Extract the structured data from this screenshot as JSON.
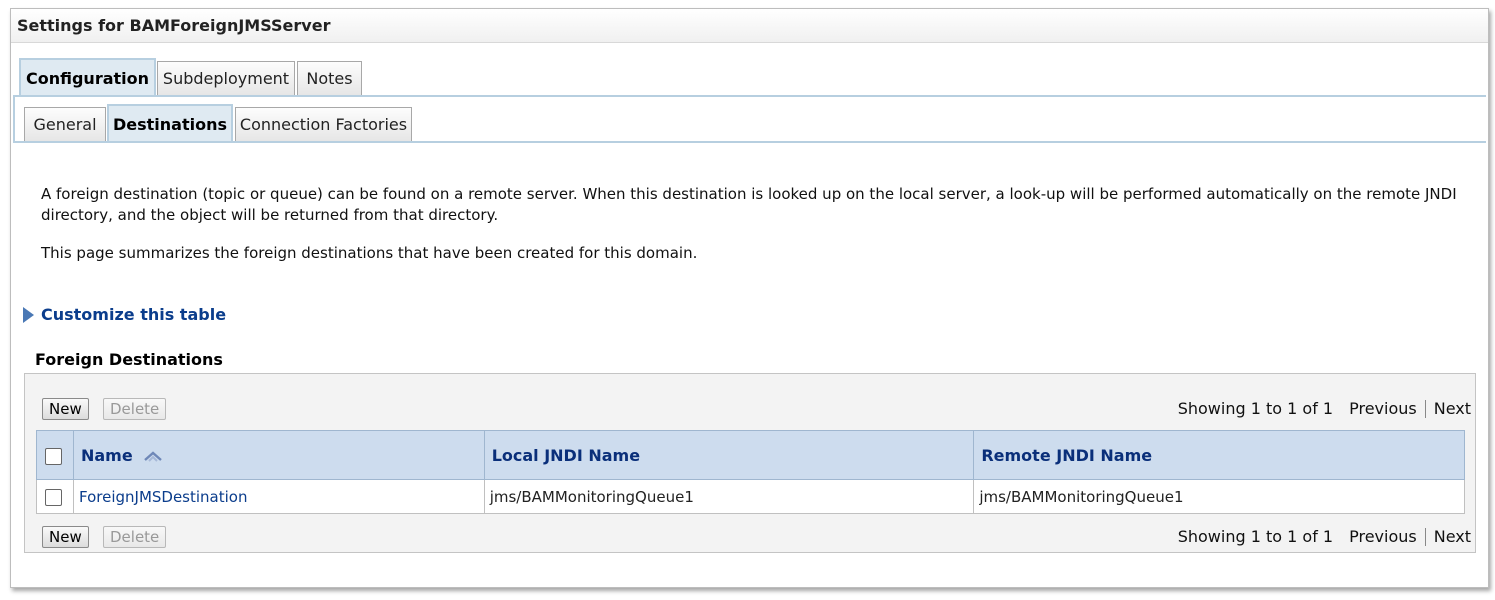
{
  "panel": {
    "title": "Settings for BAMForeignJMSServer"
  },
  "tabs_primary": [
    {
      "label": "Configuration",
      "active": true
    },
    {
      "label": "Subdeployment",
      "active": false
    },
    {
      "label": "Notes",
      "active": false
    }
  ],
  "tabs_secondary": [
    {
      "label": "General",
      "active": false
    },
    {
      "label": "Destinations",
      "active": true
    },
    {
      "label": "Connection Factories",
      "active": false
    }
  ],
  "description": {
    "p1": "A foreign destination (topic or queue) can be found on a remote server. When this destination is looked up on the local server, a look-up will be performed automatically on the remote JNDI directory, and the object will be returned from that directory.",
    "p2": "This page summarizes the foreign destinations that have been created for this domain."
  },
  "customize": {
    "label": "Customize this table",
    "icon": "expand-triangle-icon"
  },
  "table": {
    "title": "Foreign Destinations",
    "buttons": {
      "new": "New",
      "delete": "Delete"
    },
    "pager": {
      "showing": "Showing 1 to 1 of 1",
      "previous": "Previous",
      "next": "Next"
    },
    "columns": [
      "Name",
      "Local JNDI Name",
      "Remote JNDI Name"
    ],
    "rows": [
      {
        "name": "ForeignJMSDestination",
        "local_jndi": "jms/BAMMonitoringQueue1",
        "remote_jndi": "jms/BAMMonitoringQueue1"
      }
    ]
  },
  "colors": {
    "header_bg": "#cddcee",
    "link": "#0b3d8c",
    "tab_active": "#dfeaf2"
  }
}
